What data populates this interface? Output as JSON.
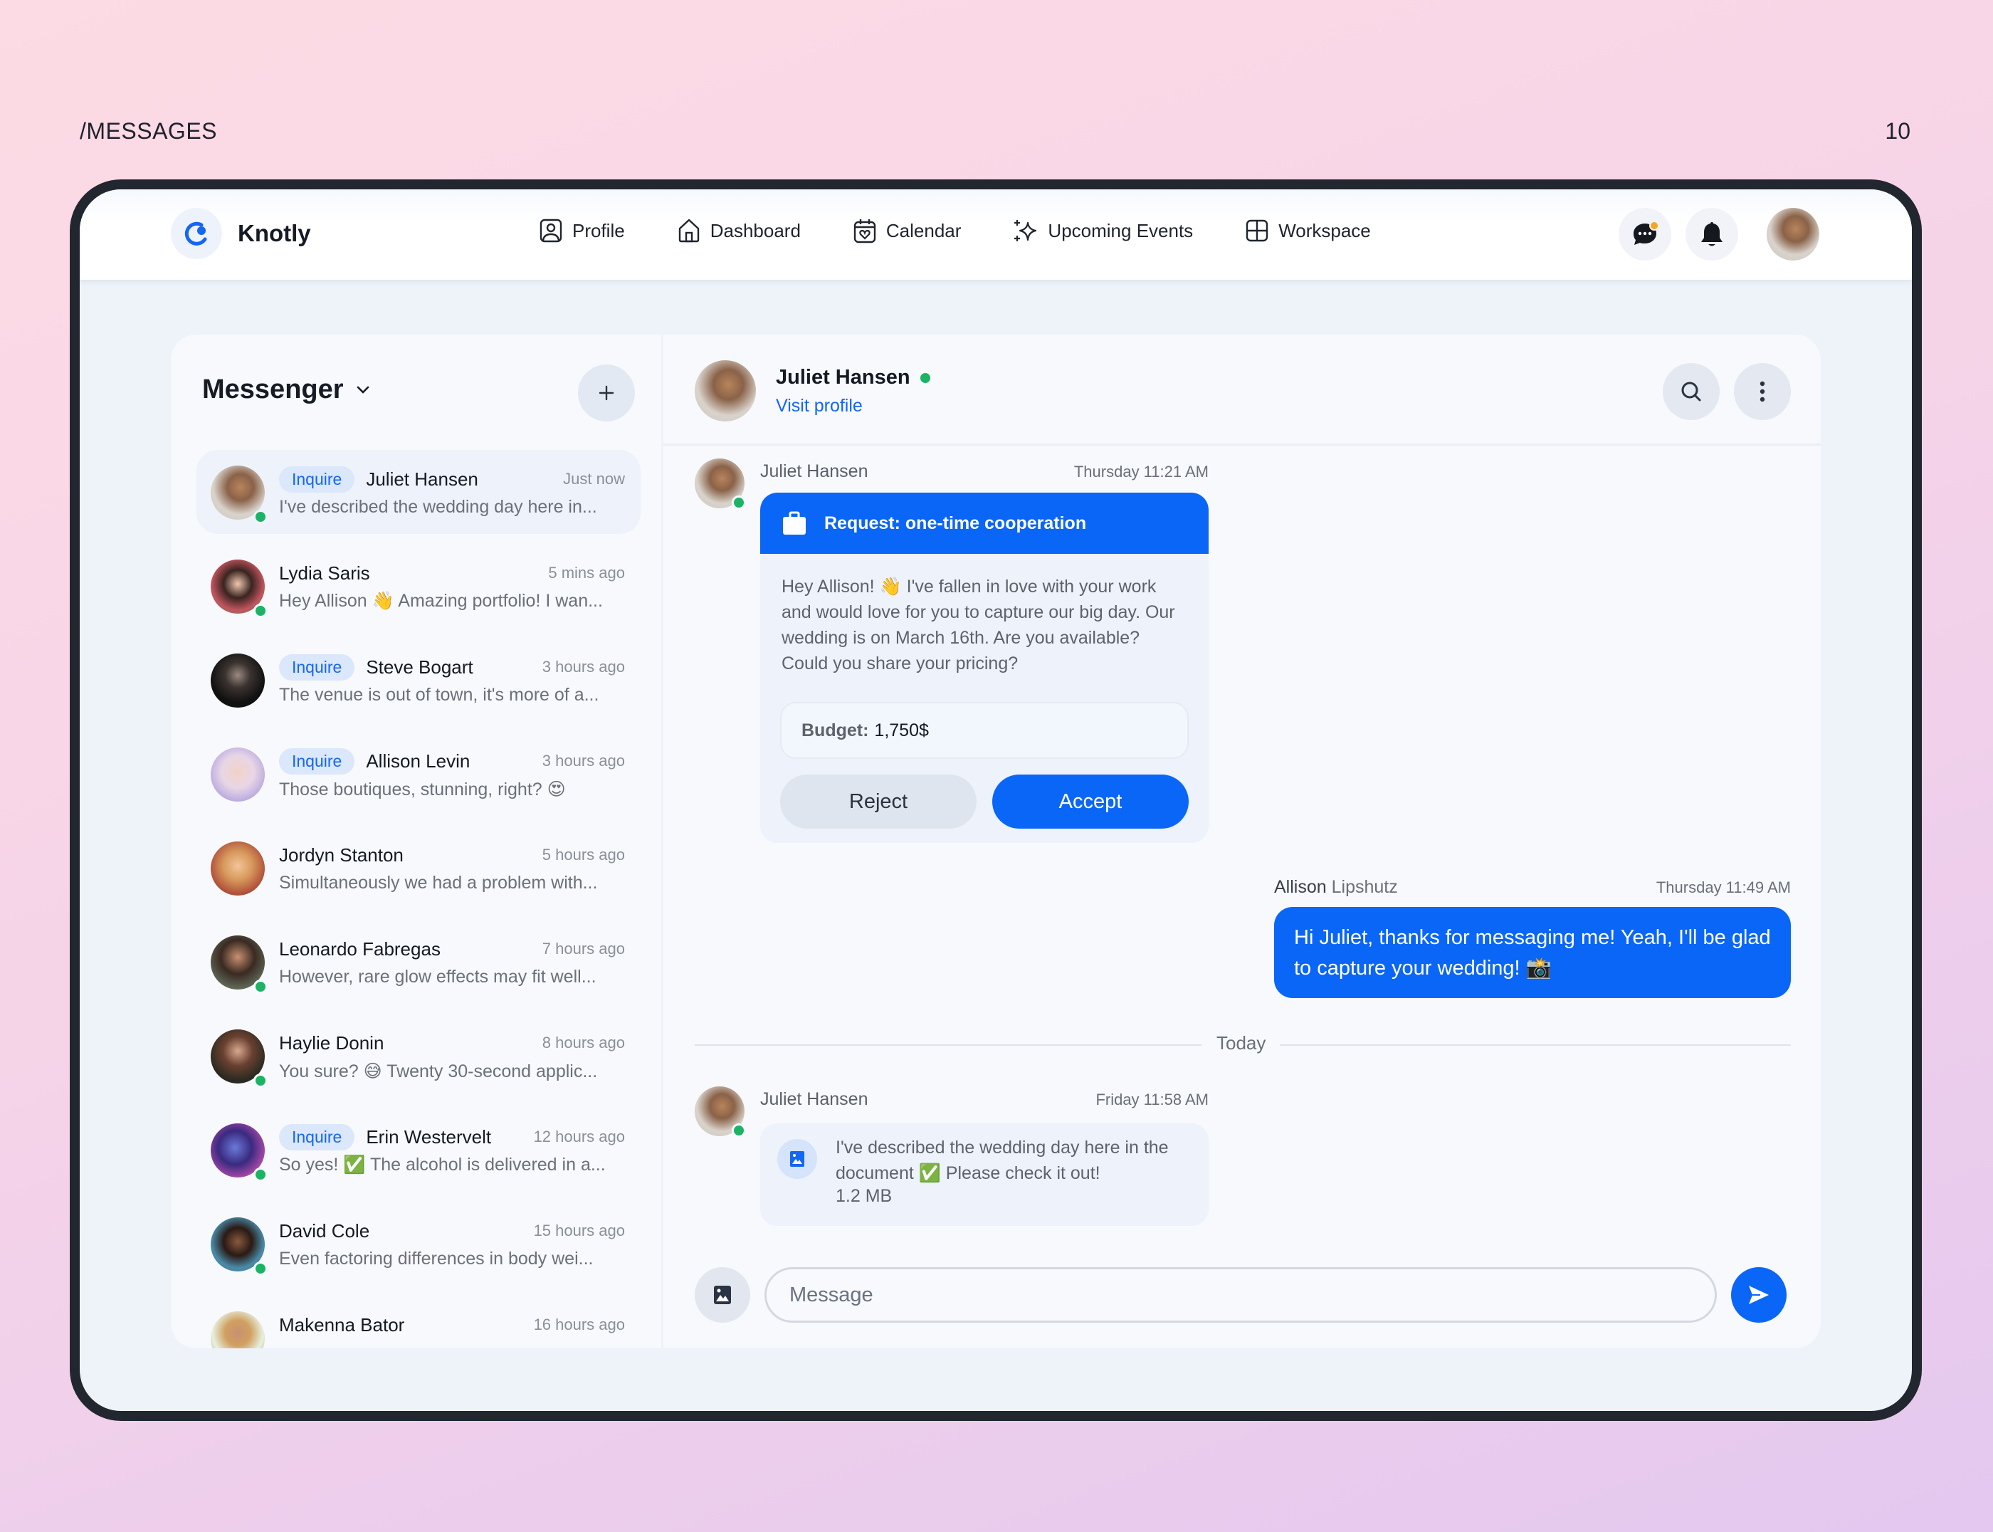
{
  "page": {
    "section_label": "/MESSAGES",
    "page_number": "10"
  },
  "header": {
    "brand": "Knotly",
    "nav": [
      {
        "label": "Profile",
        "icon": "profile-icon"
      },
      {
        "label": "Dashboard",
        "icon": "home-icon"
      },
      {
        "label": "Calendar",
        "icon": "calendar-heart-icon"
      },
      {
        "label": "Upcoming Events",
        "icon": "sparkle-icon"
      },
      {
        "label": "Workspace",
        "icon": "grid-icon"
      }
    ],
    "actions": {
      "messages_icon": "chat-bubble-icon",
      "notifications_icon": "bell-icon",
      "has_unread": true
    }
  },
  "messenger": {
    "title": "Messenger",
    "add_label": "+",
    "conversations": [
      {
        "name": "Juliet Hansen",
        "badge": "Inquire",
        "time": "Just now",
        "preview": "I've described the wedding day here in...",
        "online": true,
        "active": true
      },
      {
        "name": "Lydia Saris",
        "badge": "",
        "time": "5 mins ago",
        "preview": "Hey Allison 👋 Amazing portfolio! I wan...",
        "online": true
      },
      {
        "name": "Steve Bogart",
        "badge": "Inquire",
        "time": "3 hours ago",
        "preview": "The venue is out of town, it's more of a...",
        "online": false
      },
      {
        "name": "Allison Levin",
        "badge": "Inquire",
        "time": "3 hours ago",
        "preview": "Those boutiques, stunning, right? 😍",
        "online": false
      },
      {
        "name": "Jordyn Stanton",
        "badge": "",
        "time": "5 hours ago",
        "preview": "Simultaneously we had a problem with...",
        "online": false
      },
      {
        "name": "Leonardo Fabregas",
        "badge": "",
        "time": "7 hours ago",
        "preview": "However, rare glow effects may fit well...",
        "online": true
      },
      {
        "name": "Haylie Donin",
        "badge": "",
        "time": "8 hours ago",
        "preview": "You sure? 😅 Twenty 30-second applic...",
        "online": true
      },
      {
        "name": "Erin Westervelt",
        "badge": "Inquire",
        "time": "12 hours ago",
        "preview": "So yes! ✅ The alcohol is delivered in a...",
        "online": true
      },
      {
        "name": "David Cole",
        "badge": "",
        "time": "15 hours ago",
        "preview": "Even factoring differences in body wei...",
        "online": true
      },
      {
        "name": "Makenna Bator",
        "badge": "",
        "time": "16 hours ago",
        "preview": "",
        "online": false
      }
    ]
  },
  "chat": {
    "contact_name": "Juliet Hansen",
    "contact_online": true,
    "visit_profile": "Visit profile",
    "messages": {
      "request": {
        "sender": "Juliet Hansen",
        "time": "Thursday 11:21 AM",
        "title": "Request: one-time cooperation",
        "body": "Hey Allison! 👋 I've fallen in love with your work and would love for you to capture our big day. Our wedding is on March 16th. Are you available? Could you share your pricing?",
        "budget_label": "Budget:",
        "budget_value": "1,750$",
        "reject_label": "Reject",
        "accept_label": "Accept"
      },
      "reply": {
        "sender_first": "Allison",
        "sender_last": "Lipshutz",
        "time": "Thursday 11:49 AM",
        "text": "Hi Juliet, thanks for messaging me! Yeah, I'll be glad to capture your wedding! 📸"
      },
      "divider": "Today",
      "file": {
        "sender": "Juliet Hansen",
        "time": "Friday 11:58 AM",
        "text": "I've described the wedding day here in the document ✅ Please check it out!",
        "size": "1.2 MB"
      }
    },
    "composer": {
      "placeholder": "Message",
      "value": ""
    }
  },
  "colors": {
    "accent": "#0a66f7",
    "online": "#1cb364",
    "badge_bg": "#dbe7fb",
    "notification_dot": "#f5a623",
    "frame": "#22262e"
  }
}
